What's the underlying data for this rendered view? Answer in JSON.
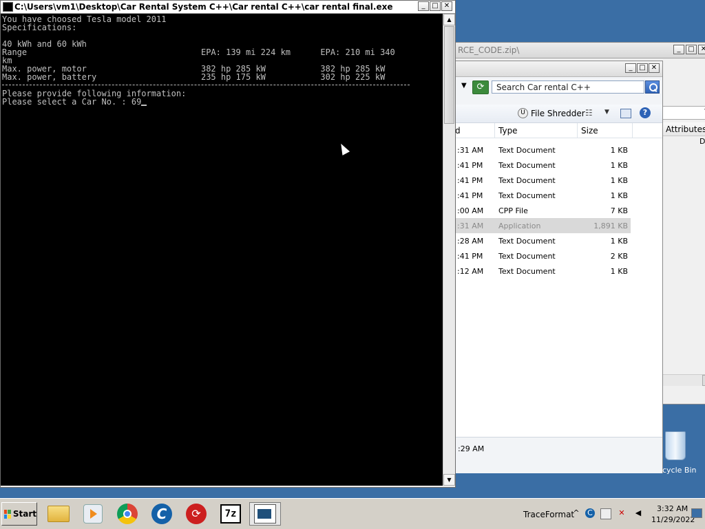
{
  "zip_window": {
    "title": "RCE_CODE.zip\\",
    "column_attributes": "Attributes",
    "attr_row_value": "D"
  },
  "explorer": {
    "search_placeholder": "Search Car rental C++",
    "file_shredder": "File Shredder",
    "columns": {
      "modified": "d",
      "type": "Type",
      "size": "Size"
    },
    "rows": [
      {
        "time": ":31 AM",
        "type": "Text Document",
        "size": "1 KB"
      },
      {
        "time": ":41 PM",
        "type": "Text Document",
        "size": "1 KB"
      },
      {
        "time": ":41 PM",
        "type": "Text Document",
        "size": "1 KB"
      },
      {
        "time": ":41 PM",
        "type": "Text Document",
        "size": "1 KB"
      },
      {
        "time": ":00 AM",
        "type": "CPP File",
        "size": "7 KB"
      },
      {
        "time": ":31 AM",
        "type": "Application",
        "size": "1,891 KB"
      },
      {
        "time": ":28 AM",
        "type": "Text Document",
        "size": "1 KB"
      },
      {
        "time": ":41 PM",
        "type": "Text Document",
        "size": "2 KB"
      },
      {
        "time": ":12 AM",
        "type": "Text Document",
        "size": "1 KB"
      }
    ],
    "details_time": ":29 AM"
  },
  "console": {
    "title": "C:\\Users\\vm1\\Desktop\\Car Rental System C++\\Car rental C++\\car rental final.exe",
    "lines": {
      "l1": "You have choosed Tesla model 2011",
      "l2": "Specifications:",
      "l3": "",
      "l4": "40 kWh and 60 kWh",
      "l5": "Range                                   EPA: 139 mi 224 km      EPA: 210 mi 340",
      "l6": "km",
      "l7": "Max. power, motor                       382 hp 285 kW           382 hp 285 kW",
      "l8": "Max. power, battery                     235 hp 175 kW           302 hp 225 kW",
      "l9": "Please provide following information:",
      "l10": "Please select a Car No. : 69"
    }
  },
  "desktop": {
    "recycle_bin_label": "cycle Bin"
  },
  "taskbar": {
    "start_label": "Start",
    "tray_app": "TraceFormat",
    "clock_time": "3:32 AM",
    "clock_date": "11/29/2022",
    "icons": [
      "folder-icon",
      "media-player-icon",
      "chrome-icon",
      "ccleaner-icon",
      "red-app-icon",
      "7zip-icon",
      "console-icon"
    ]
  },
  "window_controls": {
    "minimize": "_",
    "maximize": "□",
    "close": "✕"
  }
}
